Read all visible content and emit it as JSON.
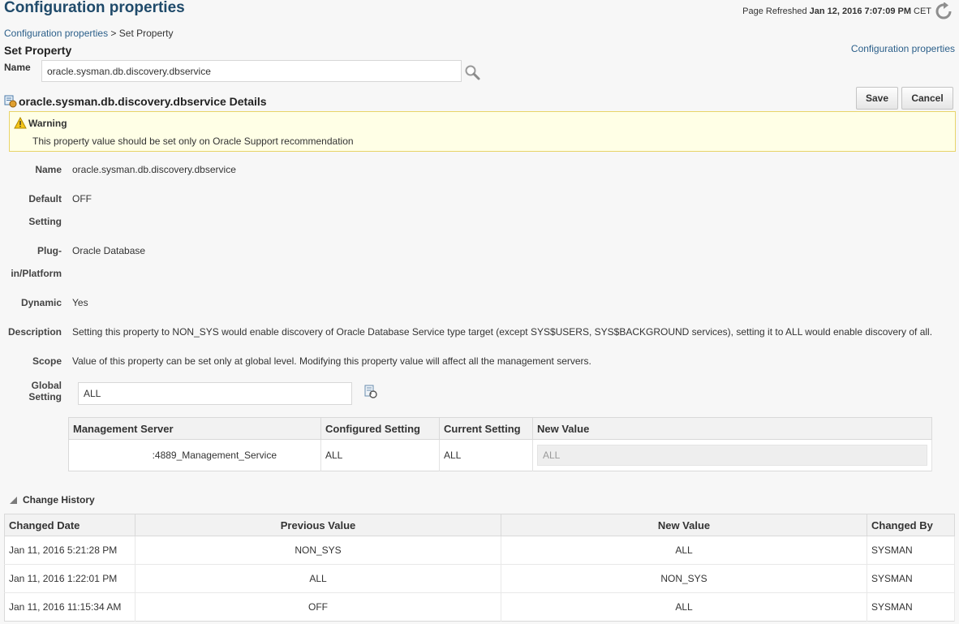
{
  "header": {
    "title": "Configuration properties",
    "refresh_label": "Page Refreshed",
    "refresh_time": "Jan 12, 2016 7:07:09 PM",
    "refresh_tz": "CET"
  },
  "breadcrumb": {
    "parent": "Configuration properties",
    "separator": ">",
    "current": "Set Property"
  },
  "section_title": "Set Property",
  "top_link": "Configuration properties",
  "name_field": {
    "label": "Name",
    "value": "oracle.sysman.db.discovery.dbservice"
  },
  "details": {
    "title": "oracle.sysman.db.discovery.dbservice Details",
    "save_label": "Save",
    "cancel_label": "Cancel"
  },
  "warning": {
    "title": "Warning",
    "text": "This property value should be set only on Oracle Support recommendation"
  },
  "props": {
    "name_label": "Name",
    "name_value": "oracle.sysman.db.discovery.dbservice",
    "default_label_1": "Default",
    "default_label_2": "Setting",
    "default_value": "OFF",
    "plugin_label_1": "Plug-",
    "plugin_label_2": "in/Platform",
    "plugin_value": "Oracle Database",
    "dynamic_label": "Dynamic",
    "dynamic_value": "Yes",
    "description_label": "Description",
    "description_value": "Setting this property to NON_SYS would enable discovery of Oracle Database Service type target (except SYS$USERS, SYS$BACKGROUND services), setting it to ALL would enable discovery of all.",
    "scope_label": "Scope",
    "scope_value": "Value of this property can be set only at global level. Modifying this property value will affect all the management servers.",
    "global_label_1": "Global",
    "global_label_2": "Setting",
    "global_value": "ALL"
  },
  "ms_table": {
    "headers": [
      "Management Server",
      "Configured Setting",
      "Current Setting",
      "New Value"
    ],
    "rows": [
      {
        "server": ":4889_Management_Service",
        "configured": "ALL",
        "current": "ALL",
        "new_value": "ALL"
      }
    ]
  },
  "history": {
    "title": "Change History",
    "headers": [
      "Changed Date",
      "Previous Value",
      "New Value",
      "Changed By"
    ],
    "rows": [
      {
        "date": "Jan 11, 2016 5:21:28 PM",
        "previous": "NON_SYS",
        "new": "ALL",
        "by": "SYSMAN"
      },
      {
        "date": "Jan 11, 2016 1:22:01 PM",
        "previous": "ALL",
        "new": "NON_SYS",
        "by": "SYSMAN"
      },
      {
        "date": "Jan 11, 2016 11:15:34 AM",
        "previous": "OFF",
        "new": "ALL",
        "by": "SYSMAN"
      }
    ]
  },
  "icons": {
    "refresh": "refresh-icon",
    "search": "search-icon",
    "details": "property-details-icon",
    "warning": "warning-icon",
    "global": "revert-setting-icon",
    "collapse": "collapse-triangle-icon"
  },
  "colors": {
    "title": "#1f4a6a",
    "link": "#2b5f8a",
    "warning_bg": "#ffffe6",
    "warning_border": "#e8d46a"
  }
}
